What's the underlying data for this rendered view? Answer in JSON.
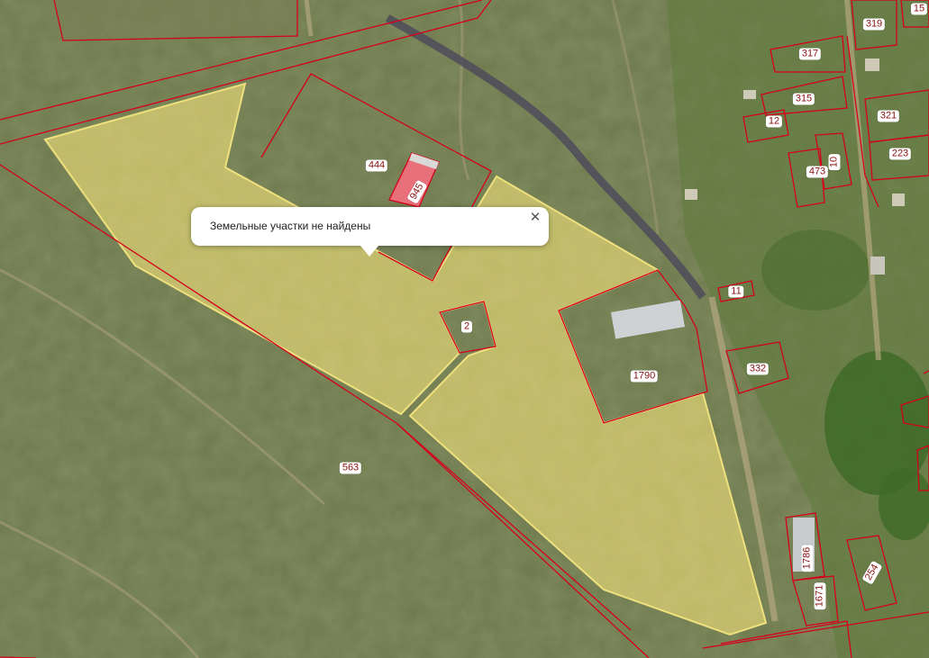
{
  "map": {
    "colors": {
      "highlight_fill": "#f3e27a",
      "highlight_stroke": "#efe07e",
      "boundary": "#d6001c",
      "building_fill": "#e8707a"
    },
    "parcel_labels": [
      "444",
      "945",
      "2",
      "1790",
      "563",
      "11",
      "332",
      "319",
      "15",
      "317",
      "315",
      "12",
      "321",
      "10",
      "473",
      "223",
      "1786",
      "1671",
      "254"
    ]
  },
  "popup": {
    "message": "Земельные участки не найдены",
    "close_icon": "close-icon"
  }
}
